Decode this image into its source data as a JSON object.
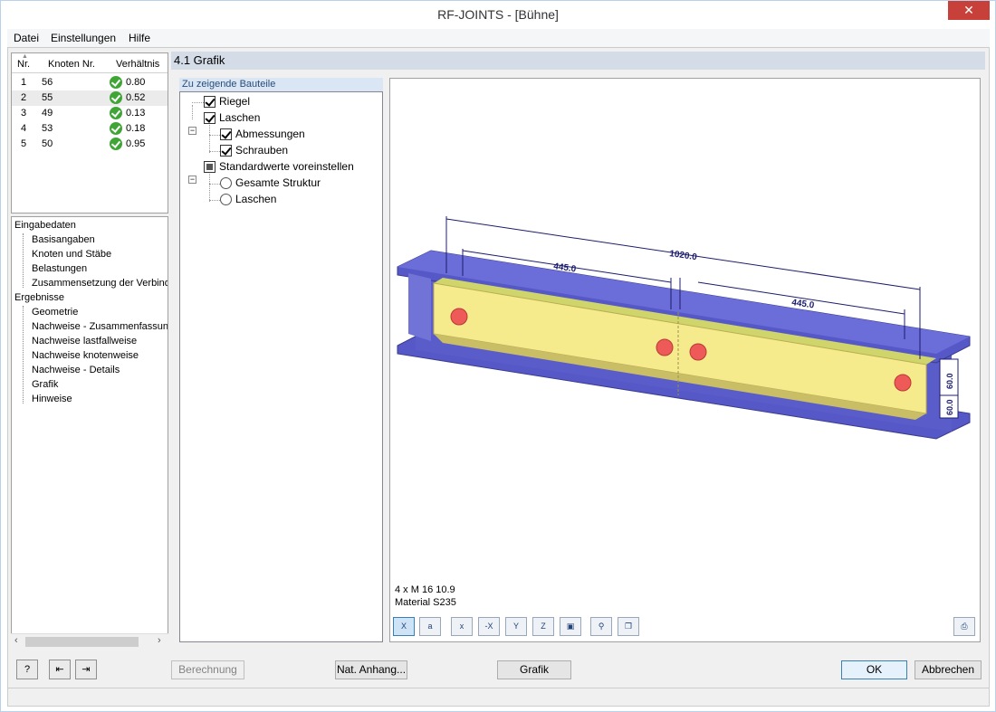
{
  "window": {
    "title": "RF-JOINTS - [Bühne]",
    "close": "✕"
  },
  "menu": {
    "items": [
      "Datei",
      "Einstellungen",
      "Hilfe"
    ]
  },
  "table": {
    "headers": {
      "nr": "Nr.",
      "knoten": "Knoten Nr.",
      "verhaeltnis": "Verhältnis"
    },
    "rows": [
      {
        "nr": "1",
        "knoten": "56",
        "ratio": "0.80"
      },
      {
        "nr": "2",
        "knoten": "55",
        "ratio": "0.52"
      },
      {
        "nr": "3",
        "knoten": "49",
        "ratio": "0.13"
      },
      {
        "nr": "4",
        "knoten": "53",
        "ratio": "0.18"
      },
      {
        "nr": "5",
        "knoten": "50",
        "ratio": "0.95"
      }
    ],
    "selected_row": 2
  },
  "nav": {
    "eingabe": "Eingabedaten",
    "eingabe_items": [
      "Basisangaben",
      "Knoten und Stäbe",
      "Belastungen",
      "Zusammensetzung der Verbindung"
    ],
    "ergebnisse": "Ergebnisse",
    "ergebnisse_items": [
      "Geometrie",
      "Nachweise - Zusammenfassung",
      "Nachweise lastfallweise",
      "Nachweise knotenweise",
      "Nachweise - Details",
      "Grafik",
      "Hinweise"
    ]
  },
  "section": {
    "title": "4.1 Grafik"
  },
  "options": {
    "tab": "Zu zeigende Bauteile",
    "riegel": "Riegel",
    "laschen": "Laschen",
    "abmessungen": "Abmessungen",
    "schrauben": "Schrauben",
    "standard": "Standardwerte voreinstellen",
    "gesamte": "Gesamte Struktur",
    "laschen_opt": "Laschen"
  },
  "graphic": {
    "dimensions": {
      "total": "1020.0",
      "left": "445.0",
      "right": "445.0",
      "v1": "60.0",
      "v2": "60.0"
    },
    "bolts_label": "4 x M 16 10.9",
    "material_label": "Material S235",
    "colors": {
      "beam": "#5658c8",
      "plate": "#f5eb8c",
      "bolt": "#ee5a58",
      "dim": "#1c1c6e"
    }
  },
  "toolbar": {
    "buttons": [
      "view-x",
      "view-a",
      "axis-x",
      "axis-minus-x",
      "axis-y",
      "axis-z",
      "iso",
      "zoom-search",
      "copy"
    ],
    "labels": {
      "x": "X",
      "a": "a",
      "ax": "x",
      "amx": "-X",
      "ay": "Y",
      "az": "Z"
    }
  },
  "buttons": {
    "berechnung": "Berechnung",
    "nat_anhang": "Nat. Anhang...",
    "grafik": "Grafik",
    "ok": "OK",
    "abbrechen": "Abbrechen"
  }
}
